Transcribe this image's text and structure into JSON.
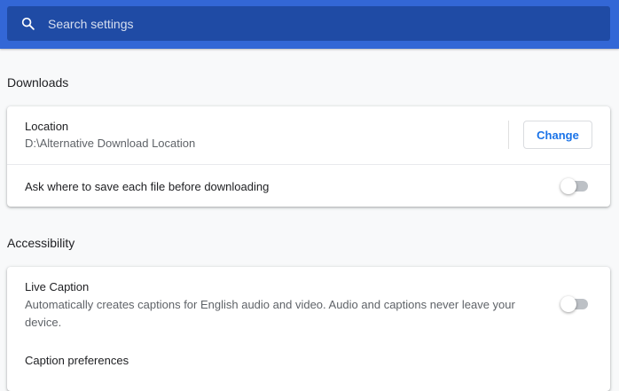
{
  "search": {
    "placeholder": "Search settings",
    "value": ""
  },
  "downloads": {
    "title": "Downloads",
    "location": {
      "label": "Location",
      "path": "D:\\Alternative Download Location",
      "button_label": "Change"
    },
    "ask_where": {
      "label": "Ask where to save each file before downloading",
      "enabled": false
    }
  },
  "accessibility": {
    "title": "Accessibility",
    "live_caption": {
      "label": "Live Caption",
      "description": "Automatically creates captions for English audio and video. Audio and captions never leave your device.",
      "enabled": false
    },
    "caption_preferences": {
      "label": "Caption preferences"
    }
  },
  "colors": {
    "header_bg": "#3367d6",
    "search_bg": "#1f4ba5",
    "accent": "#1a73e8",
    "page_bg": "#f8f9fa"
  }
}
